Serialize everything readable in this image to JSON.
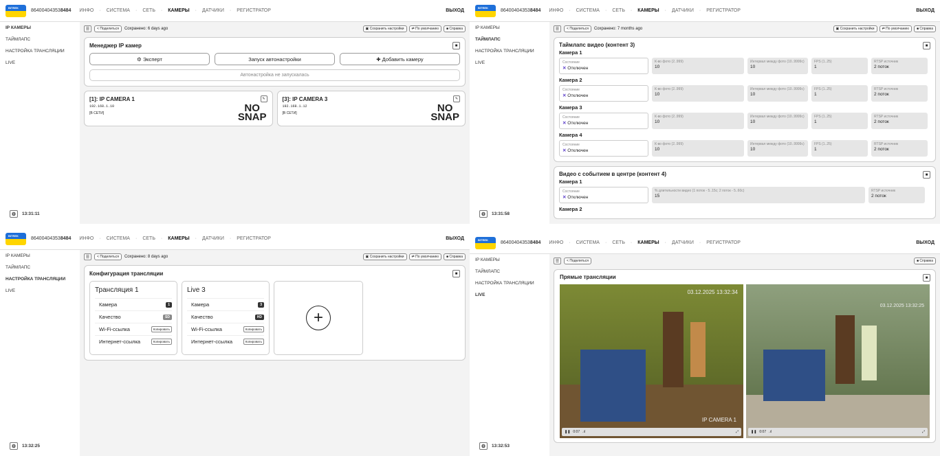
{
  "header": {
    "logo": "BITREK",
    "device_prefix": "86400404353",
    "device_bold": "8484",
    "nav": [
      "ИНФО",
      "СИСТЕМА",
      "СЕТЬ",
      "КАМЕРЫ",
      "ДАТЧИКИ",
      "РЕГИСТРАТОР"
    ],
    "exit": "ВЫХОД"
  },
  "sidebar": [
    "IP КАМЕРЫ",
    "ТАЙМЛАПС",
    "НАСТРОЙКА ТРАНСЛЯЦИИ",
    "LIVE"
  ],
  "toolbar": {
    "share": "Поделиться",
    "save": "Сохранить настройки",
    "default": "По умолчанию",
    "help": "Справка"
  },
  "q1": {
    "saved": "Сохранено: 6 days ago",
    "title": "Менеджер IP камер",
    "expert": "Эксперт",
    "autostart": "Запуск автонастройки",
    "add": "Добавить камеру",
    "autostatus": "Автонастройка не запускалась",
    "cams": [
      {
        "name": "[1]: IP CAMERA 1",
        "ip": "192.168.1.10",
        "status": "[В СЕТИ]"
      },
      {
        "name": "[3]: IP CAMERA 3",
        "ip": "192.168.1.12",
        "status": "[В СЕТИ]"
      }
    ],
    "nosnap1": "NO",
    "nosnap2": "SNAP",
    "clock": "13:31:11"
  },
  "q2": {
    "saved": "Сохранено: 7 months ago",
    "title": "Таймлапс видео (контент 3)",
    "cams": [
      "Камера 1",
      "Камера 2",
      "Камера 3",
      "Камера 4"
    ],
    "labels": {
      "state": "Состояние",
      "count": "К-во фото (2..999)",
      "interval": "Интервал между фото (10..9999с)",
      "fps": "FPS (1..25)",
      "rtsp": "RTSP источник"
    },
    "values": {
      "state": "Отключен",
      "count": "10",
      "interval": "10",
      "fps": "1",
      "rtsp": "2 поток"
    },
    "title2": "Видео с событием в центре (контент 4)",
    "pct": "% длительности видео (1 поток - 5..15с; 2 поток - 5..60с)",
    "pctval": "15",
    "clock": "13:31:58"
  },
  "q3": {
    "saved": "Сохранено: 8 days ago",
    "title": "Конфигурация трансляции",
    "cards": [
      {
        "name": "Трансляция 1",
        "cam": "1",
        "quality": "SD"
      },
      {
        "name": "Live 3",
        "cam": "3",
        "quality": "HD"
      }
    ],
    "rows": {
      "cam": "Камера",
      "quality": "Качество",
      "wifi": "Wi-Fi-ссылка",
      "inet": "Интернет-ссылка",
      "copy": "Копировать"
    },
    "clock": "13:32:25"
  },
  "q4": {
    "title": "Прямые трансляции",
    "ts1": "03.12.2025 13:32:34",
    "ts2": "03.12.2025 13:32:25",
    "name1": "IP CAMERA 1",
    "time": "0:07",
    "clock": "13:32:53"
  }
}
